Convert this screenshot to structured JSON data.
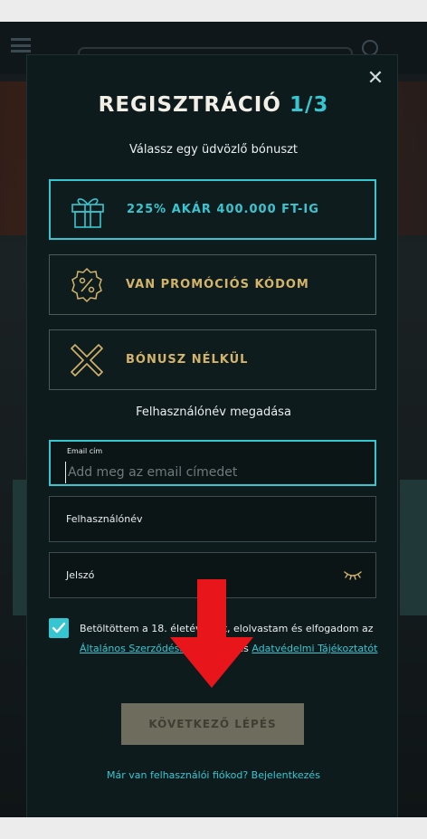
{
  "modal": {
    "title": "REGISZTRÁCIÓ",
    "step": "1/3",
    "subtitle": "Válassz egy üdvözlő bónuszt",
    "close_icon": "close-icon"
  },
  "bonus_options": [
    {
      "label": "225% AKÁR 400.000 FT-IG",
      "icon": "gift-icon",
      "selected": true
    },
    {
      "label": "VAN PROMÓCIÓS KÓDOM",
      "icon": "percent-badge-icon",
      "selected": false
    },
    {
      "label": "BÓNUSZ NÉLKÜL",
      "icon": "x-icon",
      "selected": false
    }
  ],
  "form": {
    "section_label": "Felhasználónév megadása",
    "email": {
      "label": "Email cím",
      "placeholder": "Add meg az email címedet",
      "value": ""
    },
    "username": {
      "label": "Felhasználónév"
    },
    "password": {
      "label": "Jelszó",
      "icon": "eye-closed-icon"
    }
  },
  "terms": {
    "checked": true,
    "text_before": "Betöltöttem a 18. életévemet, elolvastam és elfogadom az",
    "link1": "Általános Szerződési Feltételek",
    "text_between": " és",
    "link2": "Adatvédelmi Tájékoztatót"
  },
  "buttons": {
    "next": "KÖVETKEZŐ LÉPÉS"
  },
  "footer": {
    "login_prompt": "Már van felhasználói fiókod? Bejelentkezés"
  },
  "colors": {
    "accent": "#36c6d1",
    "gold": "#d2b46b",
    "modal_bg": "#0e1b1c",
    "arrow": "#e8151b"
  }
}
